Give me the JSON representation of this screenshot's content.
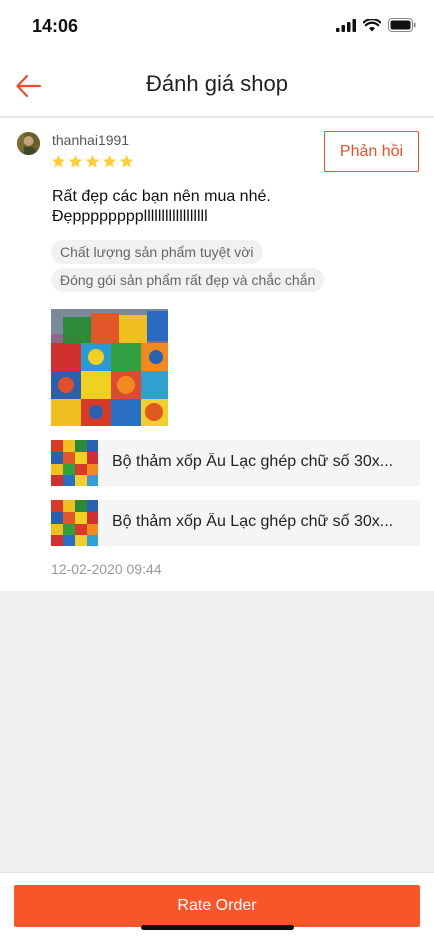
{
  "status": {
    "time": "14:06"
  },
  "nav": {
    "title": "Đánh giá shop",
    "back_icon": "arrow-left-icon"
  },
  "review": {
    "username": "thanhai1991",
    "rating": 5,
    "reply_label": "Phản hồi",
    "comment_line1": "Rất đẹp các bạn nên mua nhé.",
    "comment_line2": "Đẹppppppppllllllllllllllllll",
    "tags": [
      "Chất lượng sản phẩm tuyệt vời",
      "Đóng gói sản phẩm rất đẹp và chắc chắn"
    ],
    "products": [
      {
        "name": "Bộ thảm xốp Âu Lạc ghép chữ số 30x..."
      },
      {
        "name": "Bộ thảm xốp Âu Lạc ghép chữ số 30x..."
      }
    ],
    "date": "12-02-2020 09:44"
  },
  "footer": {
    "rate_label": "Rate Order"
  },
  "colors": {
    "accent": "#ee4d2d",
    "button": "#f6562a",
    "star": "#ffce3d"
  }
}
